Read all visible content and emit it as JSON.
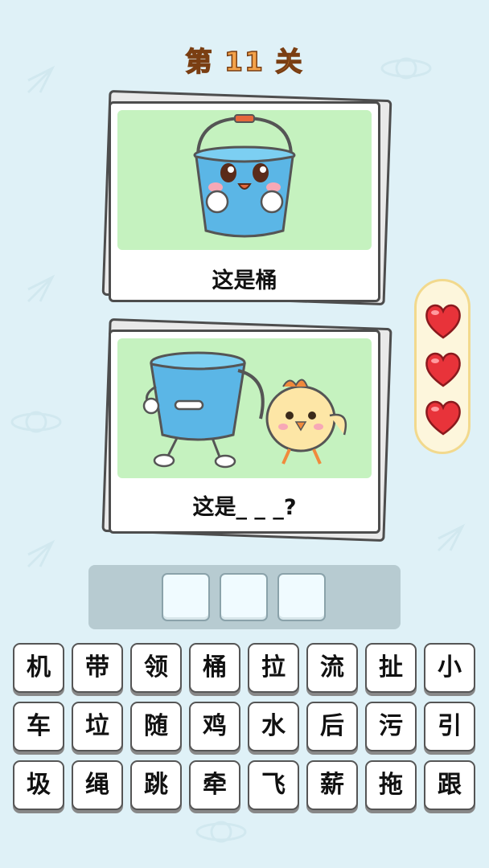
{
  "level": {
    "title": "第 11 关"
  },
  "cards": [
    {
      "caption": "这是桶",
      "picture": "smiling-blue-bucket"
    },
    {
      "caption": "这是_ _ _?",
      "picture": "bucket-walking-with-chick"
    }
  ],
  "lives": {
    "count": 3,
    "icon": "heart-icon"
  },
  "answer": {
    "slots": [
      "",
      "",
      ""
    ]
  },
  "keyboard": {
    "rows": [
      [
        "机",
        "带",
        "领",
        "桶",
        "拉",
        "流",
        "扯",
        "小"
      ],
      [
        "车",
        "垃",
        "随",
        "鸡",
        "水",
        "后",
        "污",
        "引"
      ],
      [
        "圾",
        "绳",
        "跳",
        "牵",
        "飞",
        "薪",
        "拖",
        "跟"
      ]
    ]
  },
  "colors": {
    "background": "#dff1f7",
    "title_fill": "#f3a24a",
    "title_stroke": "#7a3e12",
    "card_image_bg": "#c5f2bf",
    "heart": "#e8333a",
    "bucket": "#5bb6e6"
  }
}
